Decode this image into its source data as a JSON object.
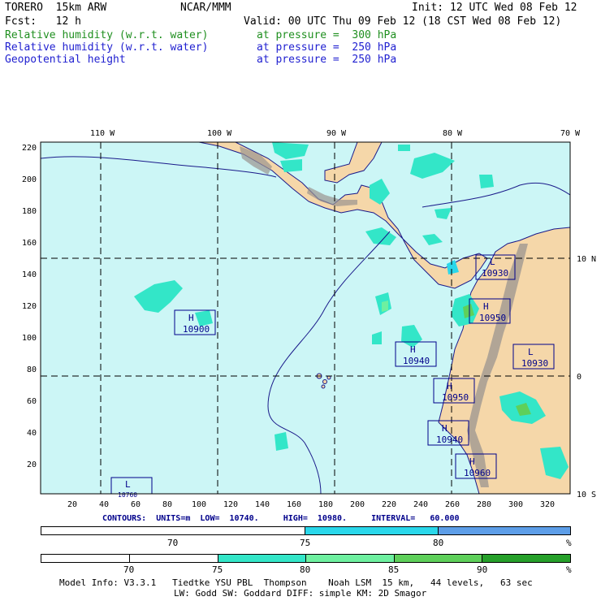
{
  "header": {
    "model": "TORERO  15km ARW",
    "org": "NCAR/MMM",
    "init": "Init: 12 UTC Wed 08 Feb 12",
    "fcst": "Fcst:   12 h",
    "valid": "Valid: 00 UTC Thu 09 Feb 12 (18 CST Wed 08 Feb 12)",
    "fields": [
      {
        "name": "Relative humidity (w.r.t. water)",
        "level": "at pressure =  300 hPa",
        "color": "#1f8f1f"
      },
      {
        "name": "Relative humidity (w.r.t. water)",
        "level": "at pressure =  250 hPa",
        "color": "#1f1fd0"
      },
      {
        "name": "Geopotential height",
        "level": "at pressure =  250 hPa",
        "color": "#1f1fd0"
      }
    ]
  },
  "map": {
    "lon_labels": [
      "110 W",
      "100 W",
      "90 W",
      "80 W",
      "70 W"
    ],
    "lat_labels": [
      "10 N",
      "0",
      "10 S"
    ],
    "y_ticks": [
      "220",
      "200",
      "180",
      "160",
      "140",
      "120",
      "100",
      "80",
      "60",
      "40",
      "20"
    ],
    "x_ticks": [
      "20",
      "40",
      "60",
      "80",
      "100",
      "120",
      "140",
      "160",
      "180",
      "200",
      "220",
      "240",
      "260",
      "280",
      "300",
      "320"
    ],
    "highs_lows": [
      {
        "type": "L",
        "value": "10930"
      },
      {
        "type": "H",
        "value": "10950"
      },
      {
        "type": "H",
        "value": "10900"
      },
      {
        "type": "H",
        "value": "10940"
      },
      {
        "type": "L",
        "value": "10930"
      },
      {
        "type": "H",
        "value": "10950"
      },
      {
        "type": "H",
        "value": "10940"
      },
      {
        "type": "H",
        "value": "10960"
      },
      {
        "type": "L",
        "value": "10760"
      }
    ],
    "colors": {
      "ocean": "#ccf6f6",
      "land": "#f5d7a9",
      "mountain": "#9a9490",
      "coast": "#1a1a8a"
    }
  },
  "contours": {
    "label": "CONTOURS:  UNITS=m  LOW=  10740.     HIGH=  10980.     INTERVAL=   60.000"
  },
  "colorbar_250": {
    "labels": [
      "70",
      "75",
      "80"
    ],
    "unit": "%",
    "colors": [
      "#ffffff",
      "#2ad7ea",
      "#5d9ee8"
    ]
  },
  "colorbar_300": {
    "labels": [
      "70",
      "75",
      "80",
      "85",
      "90"
    ],
    "unit": "%",
    "colors": [
      "#ffffff",
      "#ffffff",
      "#33e6c8",
      "#6ef0a0",
      "#5ed05a",
      "#26a02a"
    ]
  },
  "footer": {
    "line1": "Model Info: V3.3.1   Tiedtke YSU PBL  Thompson    Noah LSM  15 km,   44 levels,   63 sec",
    "line2": "LW: Godd SW: Goddard DIFF: simple KM: 2D Smagor"
  }
}
